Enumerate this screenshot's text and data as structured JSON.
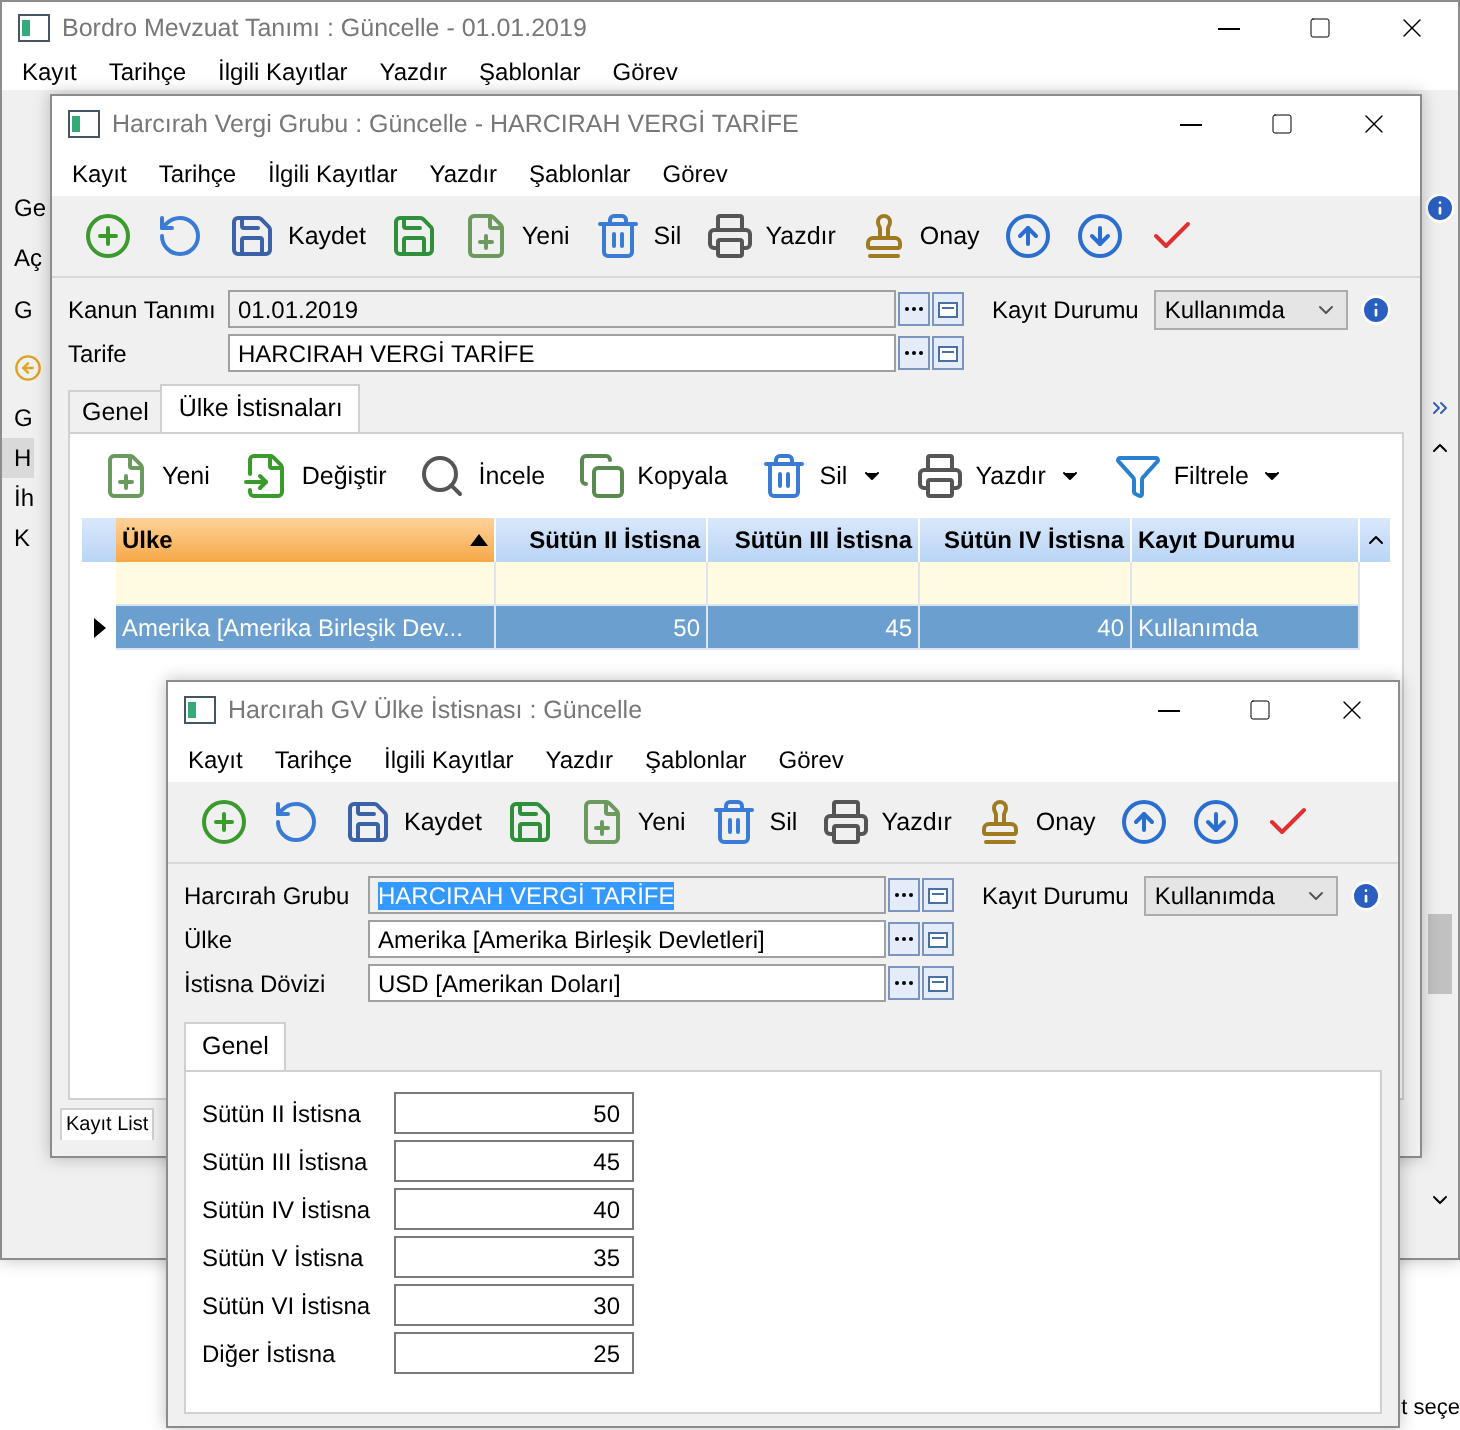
{
  "back_window": {
    "title": "Bordro Mevzuat Tanımı : Güncelle - 01.01.2019",
    "menu": [
      "Kayıt",
      "Tarihçe",
      "İlgili Kayıtlar",
      "Yazdır",
      "Şablonlar",
      "Görev"
    ],
    "left_fragments": [
      {
        "kind": "label",
        "text": "Ge"
      },
      {
        "kind": "label",
        "text": "Aç"
      },
      {
        "kind": "tab",
        "text": "G"
      },
      {
        "kind": "icon"
      },
      {
        "kind": "item",
        "text": "G",
        "selected": false
      },
      {
        "kind": "item",
        "text": "H",
        "selected": true
      },
      {
        "kind": "item",
        "text": "İh",
        "selected": false
      },
      {
        "kind": "item",
        "text": "K",
        "selected": false
      }
    ],
    "footer_fragment": "t seçe"
  },
  "middle_window": {
    "title": "Harcırah Vergi Grubu : Güncelle - HARCIRAH VERGİ TARİFE",
    "menu": [
      "Kayıt",
      "Tarihçe",
      "İlgili Kayıtlar",
      "Yazdır",
      "Şablonlar",
      "Görev"
    ],
    "toolbar": [
      {
        "kind": "icon"
      },
      {
        "kind": "icon"
      },
      {
        "kind": "text",
        "label": "Kaydet"
      },
      {
        "kind": "icon"
      },
      {
        "kind": "text",
        "label": "Yeni"
      },
      {
        "kind": "text",
        "label": "Sil"
      },
      {
        "kind": "text",
        "label": "Yazdır"
      },
      {
        "kind": "text",
        "label": "Onay"
      },
      {
        "kind": "icon"
      },
      {
        "kind": "icon"
      },
      {
        "kind": "icon"
      }
    ],
    "fields": [
      {
        "label": "Kanun Tanımı",
        "value": "01.01.2019",
        "readonly": true,
        "text_selected": false
      },
      {
        "label": "Tarife",
        "value": "HARCIRAH VERGİ TARİFE",
        "readonly": false,
        "text_selected": false
      }
    ],
    "status": {
      "label": "Kayıt Durumu",
      "value": "Kullanımda"
    },
    "tabs": [
      {
        "label": "Genel",
        "selected": false
      },
      {
        "label": "Ülke İstisnaları",
        "selected": true
      }
    ],
    "grid_toolbar": [
      {
        "label": "Yeni",
        "has_menu": false
      },
      {
        "label": "Değiştir",
        "has_menu": false
      },
      {
        "label": "İncele",
        "has_menu": false
      },
      {
        "label": "Kopyala",
        "has_menu": false
      },
      {
        "label": "Sil",
        "has_menu": true
      },
      {
        "label": "Yazdır",
        "has_menu": true
      },
      {
        "label": "Filtrele",
        "has_menu": true
      }
    ],
    "grid": {
      "columns": [
        {
          "label": "Ülke",
          "kind": "text",
          "sorted": true
        },
        {
          "label": "Sütün II İstisna",
          "kind": "number",
          "sorted": false
        },
        {
          "label": "Sütün III İstisna",
          "kind": "number",
          "sorted": false
        },
        {
          "label": "Sütün IV İstisna",
          "kind": "number",
          "sorted": false
        },
        {
          "label": "Kayıt Durumu",
          "kind": "text",
          "sorted": false
        }
      ],
      "rows": [
        {
          "selected": true,
          "cells": [
            "Amerika [Amerika Birleşik Dev...",
            "50",
            "45",
            "40",
            "Kullanımda"
          ]
        }
      ]
    },
    "bottom_tab": "Kayıt List"
  },
  "front_window": {
    "title": "Harcırah GV Ülke İstisnası : Güncelle",
    "menu": [
      "Kayıt",
      "Tarihçe",
      "İlgili Kayıtlar",
      "Yazdır",
      "Şablonlar",
      "Görev"
    ],
    "toolbar": [
      {
        "kind": "icon"
      },
      {
        "kind": "icon"
      },
      {
        "kind": "text",
        "label": "Kaydet"
      },
      {
        "kind": "icon"
      },
      {
        "kind": "text",
        "label": "Yeni"
      },
      {
        "kind": "text",
        "label": "Sil"
      },
      {
        "kind": "text",
        "label": "Yazdır"
      },
      {
        "kind": "text",
        "label": "Onay"
      },
      {
        "kind": "icon"
      },
      {
        "kind": "icon"
      },
      {
        "kind": "icon"
      }
    ],
    "fields": [
      {
        "label": "Harcırah Grubu",
        "value": "HARCIRAH VERGİ TARİFE",
        "readonly": true,
        "text_selected": true
      },
      {
        "label": "Ülke",
        "value": "Amerika [Amerika Birleşik Devletleri]",
        "readonly": false,
        "text_selected": false
      },
      {
        "label": "İstisna Dövizi",
        "value": "USD [Amerikan Doları]",
        "readonly": false,
        "text_selected": false
      }
    ],
    "status": {
      "label": "Kayıt Durumu",
      "value": "Kullanımda"
    },
    "tabs": [
      {
        "label": "Genel",
        "selected": true
      }
    ],
    "form": [
      {
        "label": "Sütün II İstisna",
        "value": "50"
      },
      {
        "label": "Sütün III İstisna",
        "value": "45"
      },
      {
        "label": "Sütün IV İstisna",
        "value": "40"
      },
      {
        "label": "Sütün V İstisna",
        "value": "35"
      },
      {
        "label": "Sütün VI İstisna",
        "value": "30"
      },
      {
        "label": "Diğer İstisna",
        "value": "25"
      }
    ]
  }
}
